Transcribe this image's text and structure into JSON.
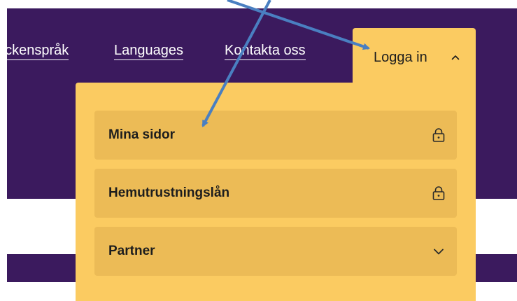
{
  "nav": {
    "links": [
      {
        "label": "eckenspråk"
      },
      {
        "label": "Languages"
      },
      {
        "label": "Kontakta oss"
      }
    ],
    "login": {
      "label": "Logga in",
      "state": "expanded",
      "chevron_icon": "chevron-up-icon"
    }
  },
  "dropdown": {
    "items": [
      {
        "label": "Mina sidor",
        "icon": "lock-icon"
      },
      {
        "label": "Hemutrustningslån",
        "icon": "lock-icon"
      },
      {
        "label": "Partner",
        "icon": "chevron-down-icon"
      }
    ]
  },
  "colors": {
    "brand_purple": "#3b1a5e",
    "accent_yellow": "#fbcb61",
    "item_background": "#ecbb56",
    "text_dark": "#1d1d1d",
    "annotation_arrow": "#4a7fc1"
  }
}
